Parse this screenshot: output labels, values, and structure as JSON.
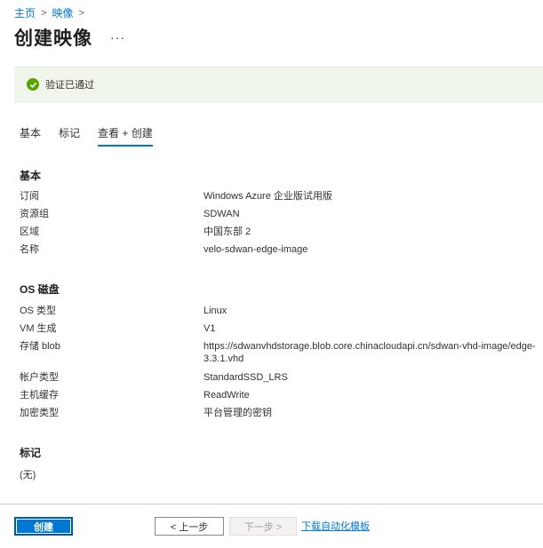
{
  "breadcrumb": {
    "home": "主页",
    "images": "映像"
  },
  "header": {
    "title": "创建映像",
    "more": "···"
  },
  "banner": {
    "text": "验证已通过"
  },
  "tabs": [
    {
      "label": "基本"
    },
    {
      "label": "标记"
    },
    {
      "label": "查看 + 创建"
    }
  ],
  "basics": {
    "title": "基本",
    "rows": [
      {
        "k": "订阅",
        "v": "Windows Azure 企业版试用版"
      },
      {
        "k": "资源组",
        "v": "SDWAN"
      },
      {
        "k": "区域",
        "v": "中国东部 2"
      },
      {
        "k": "名称",
        "v": "velo-sdwan-edge-image"
      }
    ]
  },
  "osdisk": {
    "title": "OS 磁盘",
    "rows": [
      {
        "k": "OS 类型",
        "v": "Linux"
      },
      {
        "k": "VM 生成",
        "v": "V1"
      },
      {
        "k": "存储 blob",
        "v": "https://sdwanvhdstorage.blob.core.chinacloudapi.cn/sdwan-vhd-image/edge-3.3.1.vhd"
      },
      {
        "k": "帐户类型",
        "v": "StandardSSD_LRS"
      },
      {
        "k": "主机缓存",
        "v": "ReadWrite"
      },
      {
        "k": "加密类型",
        "v": "平台管理的密钥"
      }
    ]
  },
  "tags": {
    "title": "标记",
    "none": "(无)"
  },
  "footer": {
    "create": "创建",
    "prev": "< 上一步",
    "next": "下一步 >",
    "download": "下载自动化模板"
  },
  "colors": {
    "accent": "#0078d4",
    "success": "#57a300",
    "banner_bg": "#f0f6ec"
  }
}
